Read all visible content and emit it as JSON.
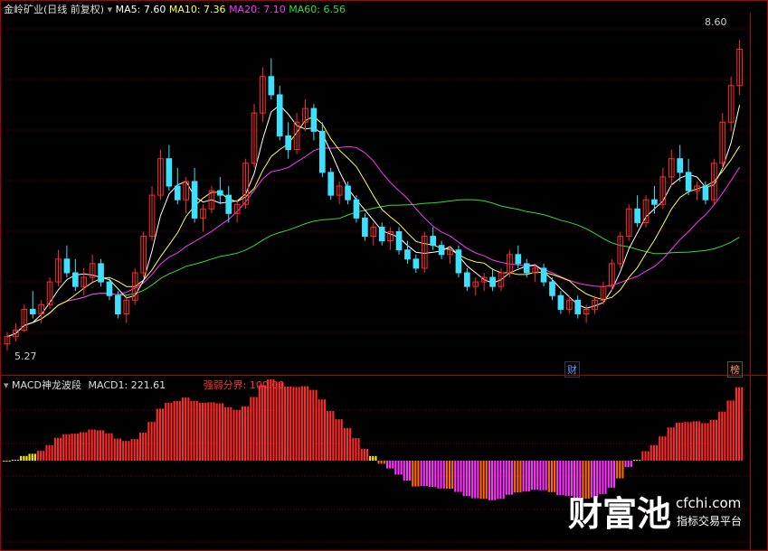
{
  "header": {
    "title": "金岭矿业(日线 前复权)",
    "ma5": "MA5: 7.60",
    "ma10": "MA10: 7.36",
    "ma20": "MA20: 7.10",
    "ma60": "MA60: 6.56"
  },
  "lower_header": {
    "title": "MACD神龙波段",
    "macd1": "MACD1: 221.61",
    "threshold": "强弱分界: 100.00"
  },
  "tags": {
    "cai": "财",
    "bang": "榜"
  },
  "watermark": {
    "brand": "财富池",
    "site": "cfchi.com",
    "slogan": "指标交易平台"
  },
  "colors": {
    "up": "#ff2a2a",
    "down": "#3fe0ff",
    "ma5": "#ffffff",
    "ma10": "#ffff44",
    "ma20": "#ff33ff",
    "ma60": "#33dd33",
    "grid": "#7a0000",
    "border": "#aa0000"
  },
  "chart_data": [
    {
      "type": "candlestick",
      "title": "金岭矿业(日线 前复权)",
      "high_label": "8.60",
      "low_label": "5.27",
      "ylim": [
        5.1,
        8.9
      ],
      "series": [
        {
          "name": "MA5",
          "value": 7.6
        },
        {
          "name": "MA10",
          "value": 7.36
        },
        {
          "name": "MA20",
          "value": 7.1
        },
        {
          "name": "MA60",
          "value": 6.56
        }
      ],
      "ohlc": [
        [
          5.27,
          5.4,
          5.2,
          5.35
        ],
        [
          5.35,
          5.5,
          5.3,
          5.42
        ],
        [
          5.42,
          5.7,
          5.4,
          5.65
        ],
        [
          5.65,
          5.85,
          5.55,
          5.6
        ],
        [
          5.6,
          5.75,
          5.5,
          5.7
        ],
        [
          5.7,
          6.0,
          5.65,
          5.95
        ],
        [
          5.95,
          6.3,
          5.9,
          6.2
        ],
        [
          6.2,
          6.35,
          6.0,
          6.05
        ],
        [
          6.05,
          6.2,
          5.85,
          5.9
        ],
        [
          5.9,
          6.1,
          5.8,
          6.0
        ],
        [
          6.0,
          6.25,
          5.95,
          6.15
        ],
        [
          6.15,
          6.2,
          5.9,
          5.95
        ],
        [
          5.95,
          6.0,
          5.75,
          5.8
        ],
        [
          5.8,
          5.85,
          5.55,
          5.6
        ],
        [
          5.6,
          5.8,
          5.5,
          5.75
        ],
        [
          5.75,
          6.1,
          5.7,
          6.05
        ],
        [
          6.05,
          6.5,
          6.0,
          6.45
        ],
        [
          6.45,
          7.0,
          6.4,
          6.9
        ],
        [
          6.9,
          7.4,
          6.85,
          7.3
        ],
        [
          7.3,
          7.45,
          6.95,
          7.0
        ],
        [
          7.0,
          7.2,
          6.8,
          6.85
        ],
        [
          6.85,
          7.1,
          6.7,
          7.05
        ],
        [
          7.05,
          7.2,
          6.6,
          6.65
        ],
        [
          6.65,
          6.8,
          6.5,
          6.75
        ],
        [
          6.75,
          7.0,
          6.7,
          6.95
        ],
        [
          6.95,
          7.1,
          6.8,
          6.9
        ],
        [
          6.9,
          7.0,
          6.6,
          6.7
        ],
        [
          6.7,
          6.85,
          6.6,
          6.8
        ],
        [
          6.8,
          7.3,
          6.75,
          7.25
        ],
        [
          7.25,
          7.9,
          7.2,
          7.8
        ],
        [
          7.8,
          8.3,
          7.7,
          8.2
        ],
        [
          8.2,
          8.4,
          7.95,
          8.0
        ],
        [
          8.0,
          8.1,
          7.5,
          7.55
        ],
        [
          7.55,
          7.7,
          7.3,
          7.4
        ],
        [
          7.4,
          7.8,
          7.35,
          7.7
        ],
        [
          7.7,
          7.95,
          7.6,
          7.85
        ],
        [
          7.85,
          7.9,
          7.5,
          7.6
        ],
        [
          7.6,
          7.7,
          7.1,
          7.15
        ],
        [
          7.15,
          7.2,
          6.85,
          6.9
        ],
        [
          6.9,
          7.05,
          6.8,
          7.0
        ],
        [
          7.0,
          7.05,
          6.8,
          6.85
        ],
        [
          6.85,
          6.9,
          6.6,
          6.65
        ],
        [
          6.65,
          6.7,
          6.4,
          6.45
        ],
        [
          6.45,
          6.6,
          6.35,
          6.55
        ],
        [
          6.55,
          6.6,
          6.35,
          6.4
        ],
        [
          6.4,
          6.55,
          6.3,
          6.5
        ],
        [
          6.5,
          6.55,
          6.25,
          6.3
        ],
        [
          6.3,
          6.4,
          6.15,
          6.2
        ],
        [
          6.2,
          6.25,
          6.05,
          6.1
        ],
        [
          6.1,
          6.5,
          6.05,
          6.45
        ],
        [
          6.45,
          6.55,
          6.3,
          6.35
        ],
        [
          6.35,
          6.4,
          6.2,
          6.25
        ],
        [
          6.25,
          6.35,
          6.15,
          6.3
        ],
        [
          6.3,
          6.35,
          6.0,
          6.05
        ],
        [
          6.05,
          6.1,
          5.85,
          5.9
        ],
        [
          5.9,
          6.0,
          5.8,
          5.95
        ],
        [
          5.95,
          6.05,
          5.85,
          6.0
        ],
        [
          6.0,
          6.1,
          5.85,
          5.9
        ],
        [
          5.9,
          6.1,
          5.85,
          6.05
        ],
        [
          6.05,
          6.3,
          6.0,
          6.25
        ],
        [
          6.25,
          6.35,
          6.1,
          6.15
        ],
        [
          6.15,
          6.2,
          6.0,
          6.05
        ],
        [
          6.05,
          6.15,
          5.95,
          6.1
        ],
        [
          6.1,
          6.15,
          5.9,
          5.95
        ],
        [
          5.95,
          6.0,
          5.75,
          5.8
        ],
        [
          5.8,
          5.85,
          5.6,
          5.65
        ],
        [
          5.65,
          5.8,
          5.6,
          5.75
        ],
        [
          5.75,
          5.8,
          5.55,
          5.6
        ],
        [
          5.6,
          5.7,
          5.5,
          5.65
        ],
        [
          5.65,
          5.8,
          5.6,
          5.75
        ],
        [
          5.75,
          5.95,
          5.7,
          5.9
        ],
        [
          5.9,
          6.2,
          5.85,
          6.15
        ],
        [
          6.15,
          6.5,
          6.1,
          6.45
        ],
        [
          6.45,
          6.8,
          6.4,
          6.75
        ],
        [
          6.75,
          6.9,
          6.55,
          6.6
        ],
        [
          6.6,
          6.9,
          6.55,
          6.85
        ],
        [
          6.85,
          7.0,
          6.7,
          6.8
        ],
        [
          6.8,
          7.2,
          6.75,
          7.1
        ],
        [
          7.1,
          7.4,
          7.0,
          7.3
        ],
        [
          7.3,
          7.45,
          7.05,
          7.15
        ],
        [
          7.15,
          7.3,
          6.9,
          6.95
        ],
        [
          6.95,
          7.05,
          6.85,
          7.0
        ],
        [
          7.0,
          7.05,
          6.8,
          6.85
        ],
        [
          6.85,
          7.3,
          6.8,
          7.25
        ],
        [
          7.25,
          7.8,
          7.2,
          7.7
        ],
        [
          7.7,
          8.2,
          7.6,
          8.1
        ],
        [
          8.1,
          8.6,
          8.0,
          8.5
        ]
      ]
    },
    {
      "type": "bar",
      "title": "MACD神龙波段",
      "series": [
        {
          "name": "MACD1",
          "value": 221.61
        },
        {
          "name": "强弱分界",
          "value": 100.0
        }
      ]
    }
  ]
}
